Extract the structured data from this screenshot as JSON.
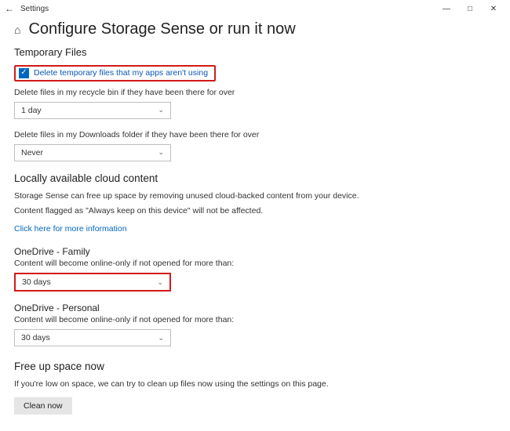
{
  "window": {
    "title": "Settings"
  },
  "page": {
    "title": "Configure Storage Sense or run it now"
  },
  "temp": {
    "section_title": "Temporary Files",
    "checkbox_label": "Delete temporary files that my apps aren't using",
    "recycle_label": "Delete files in my recycle bin if they have been there for over",
    "recycle_value": "1 day",
    "downloads_label": "Delete files in my Downloads folder if they have been there for over",
    "downloads_value": "Never"
  },
  "cloud": {
    "section_title": "Locally available cloud content",
    "desc_line1": "Storage Sense can free up space by removing unused cloud-backed content from your device.",
    "desc_line2": "Content flagged as \"Always keep on this device\" will not be affected.",
    "link_label": "Click here for more information",
    "onedrive_family": {
      "heading": "OneDrive - Family",
      "desc": "Content will become online-only if not opened for more than:",
      "value": "30 days"
    },
    "onedrive_personal": {
      "heading": "OneDrive - Personal",
      "desc": "Content will become online-only if not opened for more than:",
      "value": "30 days"
    }
  },
  "freeup": {
    "section_title": "Free up space now",
    "desc": "If you're low on space, we can try to clean up files now using the settings on this page.",
    "button_label": "Clean now"
  }
}
